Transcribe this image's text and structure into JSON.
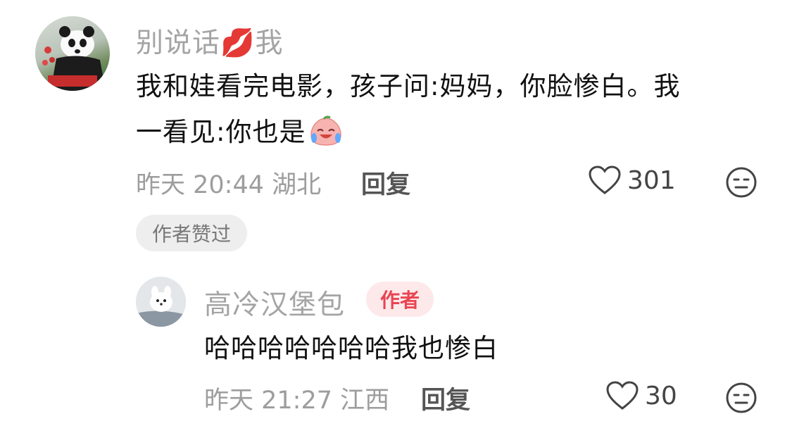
{
  "comment": {
    "username": "别说话💋我",
    "text_line1": "我和娃看完电影，孩子问:妈妈，你脸惨白。我",
    "text_line2": "一看见:你也是",
    "meta": "昨天 20:44 湖北",
    "reply_label": "回复",
    "like_count": "301",
    "author_liked_badge": "作者赞过"
  },
  "reply": {
    "username": "高冷汉堡包",
    "author_tag": "作者",
    "text": "哈哈哈哈哈哈哈我也惨白",
    "meta": "昨天 21:27 江西",
    "reply_label": "回复",
    "like_count": "30"
  },
  "icons": {
    "like": "heart-outline-icon",
    "dislike": "meh-face-icon",
    "emoji": "crying-laughing-peach-emoji"
  },
  "colors": {
    "username": "#a4a4a4",
    "author_tag_bg": "#fde9ea",
    "author_tag_text": "#e94452",
    "badge_bg": "#eeeeee"
  }
}
